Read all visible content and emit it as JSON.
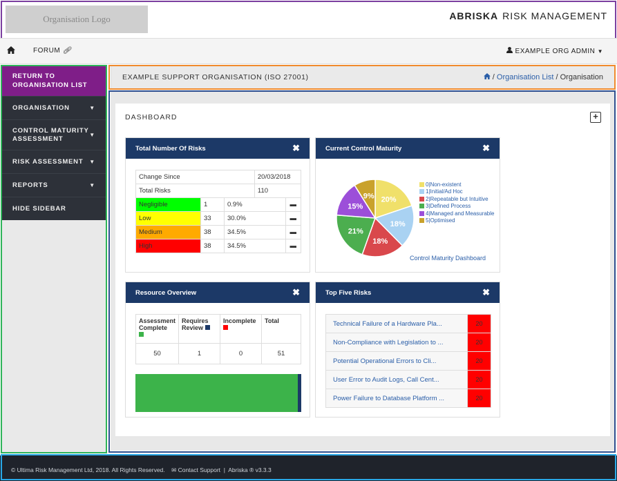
{
  "header": {
    "logo_text": "Organisation Logo",
    "brand_bold": "ABRISKA",
    "brand_rest": "RISK MANAGEMENT"
  },
  "nav": {
    "home_icon": "home-icon",
    "forum_label": "FORUM",
    "forum_icon": "link-icon",
    "user_label": "EXAMPLE ORG ADMIN",
    "user_icon": "user-icon"
  },
  "sidebar": {
    "return_line1": "RETURN TO",
    "return_line2": "ORGANISATION LIST",
    "items": [
      {
        "label": "ORGANISATION"
      },
      {
        "label_line1": "CONTROL MATURITY",
        "label_line2": "ASSESSMENT"
      },
      {
        "label": "RISK ASSESSMENT"
      },
      {
        "label": "REPORTS"
      },
      {
        "label": "HIDE SIDEBAR"
      }
    ]
  },
  "breadcrumb": {
    "title": "EXAMPLE SUPPORT ORGANISATION (ISO 27001)",
    "link": "Organisation List",
    "sep": "/",
    "current": "Organisation"
  },
  "dashboard": {
    "title": "DASHBOARD",
    "add_symbol": "+"
  },
  "risks_panel": {
    "title": "Total Number Of Risks",
    "close": "✖",
    "change_label": "Change Since",
    "change_date": "20/03/2018",
    "total_label": "Total Risks",
    "total_value": "110",
    "rows": [
      {
        "level": "Negligible",
        "count": "1",
        "pct": "0.9%",
        "trend": "▬",
        "color": "#00ff00"
      },
      {
        "level": "Low",
        "count": "33",
        "pct": "30.0%",
        "trend": "▬",
        "color": "#ffff00"
      },
      {
        "level": "Medium",
        "count": "38",
        "pct": "34.5%",
        "trend": "▬",
        "color": "#ffaa00"
      },
      {
        "level": "High",
        "count": "38",
        "pct": "34.5%",
        "trend": "▬",
        "color": "#ff0000"
      }
    ]
  },
  "maturity_panel": {
    "title": "Current Control Maturity",
    "close": "✖",
    "link": "Control Maturity Dashboard"
  },
  "chart_data": {
    "type": "pie",
    "labels": [
      "0|Non-existent",
      "1|Initial/Ad Hoc",
      "2|Repeatable but Intuitive",
      "3|Defined Process",
      "4|Managed and Measurable",
      "5|Optimised"
    ],
    "values": [
      20,
      18,
      18,
      21,
      15,
      9
    ],
    "slice_labels": [
      "20%",
      "18%",
      "18%",
      "21%",
      "15%",
      "9%"
    ],
    "colors": [
      "#f0e06a",
      "#a9d2f2",
      "#d9484c",
      "#4cae4f",
      "#9c4fd9",
      "#c9a22c"
    ],
    "legend_position": "right"
  },
  "resource_panel": {
    "title": "Resource Overview",
    "close": "✖",
    "cols": [
      {
        "l1": "Assessment",
        "l2": "Complete",
        "color": "#3cb34a"
      },
      {
        "l1": "Requires",
        "l2": "Review",
        "color": "#1c3967"
      },
      {
        "l1": "Incomplete",
        "l2": "",
        "color": "#ff0000"
      },
      {
        "l1": "Total",
        "l2": "",
        "color": ""
      }
    ],
    "values": [
      "50",
      "1",
      "0",
      "51"
    ],
    "bar_fractions": [
      {
        "value": 50,
        "color": "#3cb34a"
      },
      {
        "value": 1,
        "color": "#1c3967"
      },
      {
        "value": 0,
        "color": "#ff0000"
      }
    ]
  },
  "top_risks_panel": {
    "title": "Top Five Risks",
    "close": "✖",
    "rows": [
      {
        "name": "Technical Failure of a Hardware Pla...",
        "score": "20"
      },
      {
        "name": "Non-Compliance with Legislation to ...",
        "score": "20"
      },
      {
        "name": "Potential Operational Errors to Cli...",
        "score": "20"
      },
      {
        "name": "User Error to Audit Logs, Call Cent...",
        "score": "20"
      },
      {
        "name": "Power Failure to Database Platform ...",
        "score": "20"
      }
    ]
  },
  "footer": {
    "copyright": "© Ultima Risk Management Ltd, 2018. All Rights Reserved.",
    "contact_icon": "envelope-icon",
    "contact": "Contact Support",
    "sep": "|",
    "version": "Abriska ® v3.3.3"
  }
}
